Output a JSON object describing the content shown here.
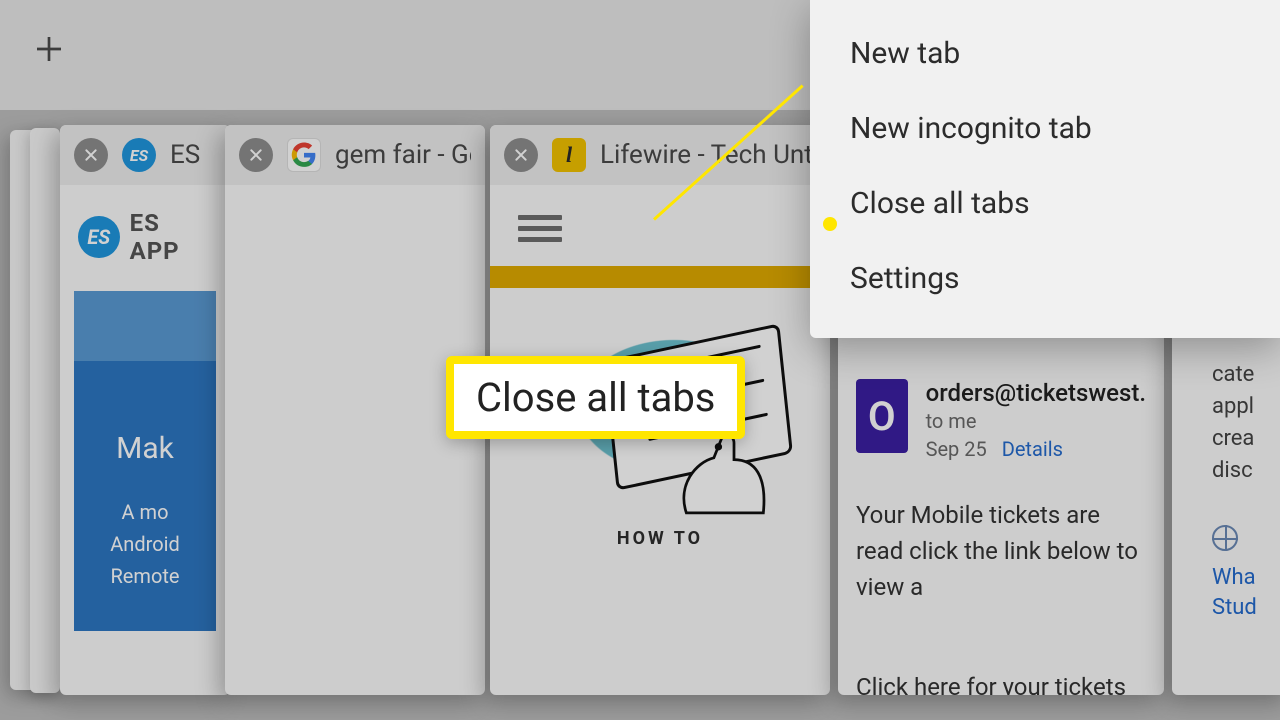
{
  "top": {
    "new_tab_icon": "plus"
  },
  "menu": {
    "items": [
      {
        "label": "New tab"
      },
      {
        "label": "New incognito tab"
      },
      {
        "label": "Close all tabs"
      },
      {
        "label": "Settings"
      }
    ]
  },
  "tabs": [
    {
      "title": "ES",
      "favicon": "es",
      "content": {
        "brand": "ES APP",
        "headline": "Mak",
        "line1": "A mo",
        "line2": "Android",
        "line3": "Remote"
      }
    },
    {
      "title": "gem fair - Go",
      "favicon": "google"
    },
    {
      "title": "Lifewire - Tech Unt",
      "favicon": "lifewire",
      "content": {
        "section_label": "HOW TO",
        "big": "HOW"
      }
    },
    {
      "title": "",
      "content": {
        "avatar_letter": "O",
        "from": "orders@ticketswest.",
        "to": "to me",
        "date": "Sep 25",
        "details": "Details",
        "para1": "Your Mobile tickets are read click the link below to view a",
        "para2": "Click here for your tickets"
      }
    },
    {
      "title": "",
      "content": {
        "frag1": "cate",
        "frag2": "appl",
        "frag3": "crea",
        "frag4": "disc",
        "link1": "Wha",
        "link2": "Stud"
      }
    }
  ],
  "callout": {
    "label": "Close all tabs"
  }
}
